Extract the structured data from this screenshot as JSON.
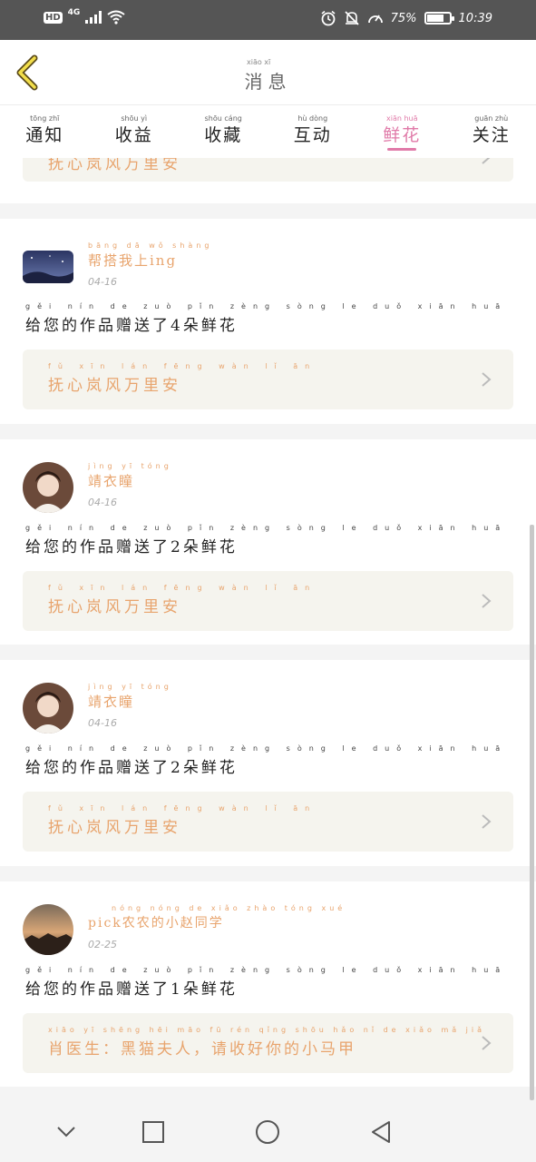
{
  "status_bar": {
    "hd": "HD",
    "network": "4G",
    "battery_text": "75%",
    "battery_level": 0.75,
    "time": "10:39"
  },
  "header": {
    "title": "消息",
    "title_pinyin": "xiāo  xī",
    "back_icon": "chevron-left-icon"
  },
  "tabs": [
    {
      "label": "通知",
      "pinyin": "tōng  zhī",
      "active": false
    },
    {
      "label": "收益",
      "pinyin": "shōu  yì",
      "active": false
    },
    {
      "label": "收藏",
      "pinyin": "shōu  cáng",
      "active": false
    },
    {
      "label": "互动",
      "pinyin": "hù  dòng",
      "active": false
    },
    {
      "label": "鲜花",
      "pinyin": "xiān  huā",
      "active": true
    },
    {
      "label": "关注",
      "pinyin": "guān  zhù",
      "active": false
    }
  ],
  "colors": {
    "accent": "#e07aa8",
    "orange": "#e8a46d",
    "work_box_bg": "#f5f4ee"
  },
  "partial_top": {
    "work_title": "抚心岚风万里安"
  },
  "messages": [
    {
      "username": "帮搭我上ing",
      "username_pinyin": "bāng dā wǒ shàng",
      "date": "04-16",
      "text": "给您的作品赠送了4朵鲜花",
      "text_pinyin": "gěi nín de zuò pǐn zèng sòng le  duǒ xiān huā",
      "work_title": "抚心岚风万里安",
      "work_pinyin": "fǔ xīn lán fēng wàn lǐ ān",
      "avatar": "night-sky-avatar"
    },
    {
      "username": "靖衣瞳",
      "username_pinyin": "jìng yī tóng",
      "date": "04-16",
      "text": "给您的作品赠送了2朵鲜花",
      "text_pinyin": "gěi nín de zuò pǐn zèng sòng le  duǒ xiān huā",
      "work_title": "抚心岚风万里安",
      "work_pinyin": "fǔ xīn lán fēng wàn lǐ ān",
      "avatar": "girl-portrait-avatar"
    },
    {
      "username": "靖衣瞳",
      "username_pinyin": "jìng yī tóng",
      "date": "04-16",
      "text": "给您的作品赠送了2朵鲜花",
      "text_pinyin": "gěi nín de zuò pǐn zèng sòng le  duǒ xiān huā",
      "work_title": "抚心岚风万里安",
      "work_pinyin": "fǔ xīn lán fēng wàn lǐ ān",
      "avatar": "girl-portrait-avatar"
    },
    {
      "username": "pick农农的小赵同学",
      "username_pinyin": "nóng nóng de xiǎo zhào tóng xué",
      "date": "02-25",
      "text": "给您的作品赠送了1朵鲜花",
      "text_pinyin": "gěi nín de zuò pǐn zèng sòng le  duǒ xiān huā",
      "work_title": "肖医生：黑猫夫人，请收好你的小马甲",
      "work_pinyin": "xiāo yī shēng  hēi māo fū rén  qǐng shōu hǎo nǐ de xiǎo mǎ jiǎ",
      "avatar": "sunset-avatar"
    }
  ],
  "navbar": {
    "buttons": [
      "chevron-down-icon",
      "square-icon",
      "circle-icon",
      "triangle-back-icon"
    ]
  }
}
